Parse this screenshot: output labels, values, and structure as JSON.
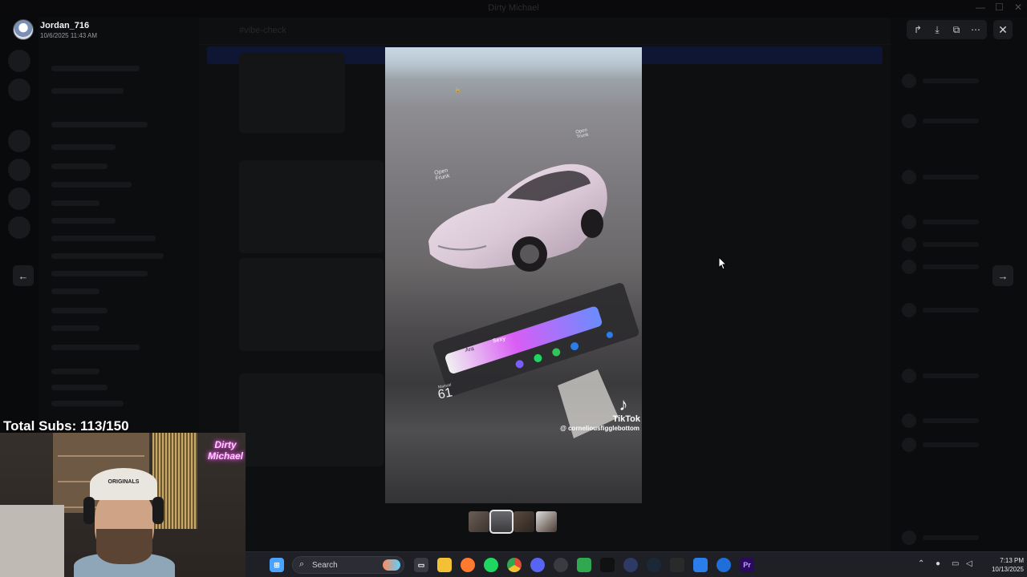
{
  "background_app": {
    "title": "Dirty Michael",
    "channel_header": "#vibe-check"
  },
  "viewer": {
    "username": "Jordan_716",
    "timestamp": "10/6/2025 11:43 AM",
    "actions": [
      {
        "icon": "forward-icon",
        "glyph": "↱"
      },
      {
        "icon": "download-icon",
        "glyph": "⤓"
      },
      {
        "icon": "open-external-icon",
        "glyph": "⧉"
      },
      {
        "icon": "more-icon",
        "glyph": "⋯"
      }
    ],
    "close_glyph": "✕",
    "prev_glyph": "←",
    "next_glyph": "→"
  },
  "media": {
    "watermark_brand": "TikTok",
    "watermark_handle": "@ corneliousfigglebottom",
    "screen_labels": {
      "open_frunk_line1": "Open",
      "open_frunk_line2": "Frunk",
      "open_trunk_line1": "Open",
      "open_trunk_line2": "Trunk",
      "assistant_mode": "Sexy",
      "assistant_voice": "Ara",
      "speed_unit": "Manual",
      "speed_value": "61"
    }
  },
  "stream_overlay": {
    "subs_label": "Total Subs: 113/150",
    "neon_sign": "Dirty Michael",
    "cap_text": "ORIGINALS"
  },
  "taskbar": {
    "search_label": "Search",
    "apps": [
      {
        "icon": "start-icon",
        "color": "#4aa3ff"
      },
      {
        "icon": "task-view-icon",
        "color": "#cfcfd6"
      },
      {
        "icon": "file-explorer-icon",
        "color": "#f3c136"
      },
      {
        "icon": "firefox-icon",
        "color": "#ff7a2e"
      },
      {
        "icon": "spotify-icon",
        "color": "#1ed760"
      },
      {
        "icon": "chrome-icon",
        "color": "#e04b3a"
      },
      {
        "icon": "discord-icon",
        "color": "#5865f2"
      },
      {
        "icon": "obs-icon",
        "color": "#3a3a40"
      },
      {
        "icon": "xbox-icon",
        "color": "#2fa84f"
      },
      {
        "icon": "capcut-icon",
        "color": "#111"
      },
      {
        "icon": "app-icon",
        "color": "#2d3a66"
      },
      {
        "icon": "steam-icon",
        "color": "#1b2838"
      },
      {
        "icon": "epic-games-icon",
        "color": "#2a2a2a"
      },
      {
        "icon": "media-player-icon",
        "color": "#2b7de9"
      },
      {
        "icon": "vpn-icon",
        "color": "#1e6fd9"
      },
      {
        "icon": "premiere-icon",
        "color": "#2a0a5e"
      }
    ],
    "time": "7:13 PM",
    "date": "10/13/2025"
  }
}
